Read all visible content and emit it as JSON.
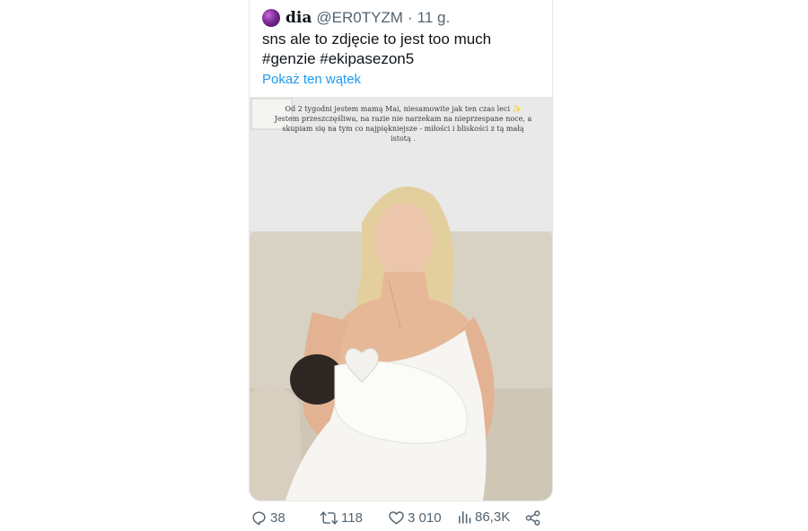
{
  "tweet": {
    "display_name": "dia",
    "handle": "@ER0TYZM",
    "separator": "·",
    "time": "11 g.",
    "text": "sns ale to zdjęcie to jest too much #genzie #ekipasezon5",
    "show_thread": "Pokaż ten wątek"
  },
  "media": {
    "caption": "Od 2 tygodni jestem mamą Mai, niesamowite jak ten czas leci ✨ Jestem przeszczęśliwa, na razie nie narzekam na nieprzespane noce, a skupiam się na tym co najpiękniejsze - miłości i bliskości z tą małą istotą ."
  },
  "actions": {
    "replies": "38",
    "retweets": "118",
    "likes": "3 010",
    "views": "86,3K"
  },
  "icons": {
    "reply": "reply-icon",
    "retweet": "retweet-icon",
    "like": "heart-icon",
    "views": "views-icon",
    "share": "share-icon"
  },
  "colors": {
    "link": "#1d9bf0",
    "secondary_text": "#536471",
    "primary_text": "#0f1419"
  }
}
